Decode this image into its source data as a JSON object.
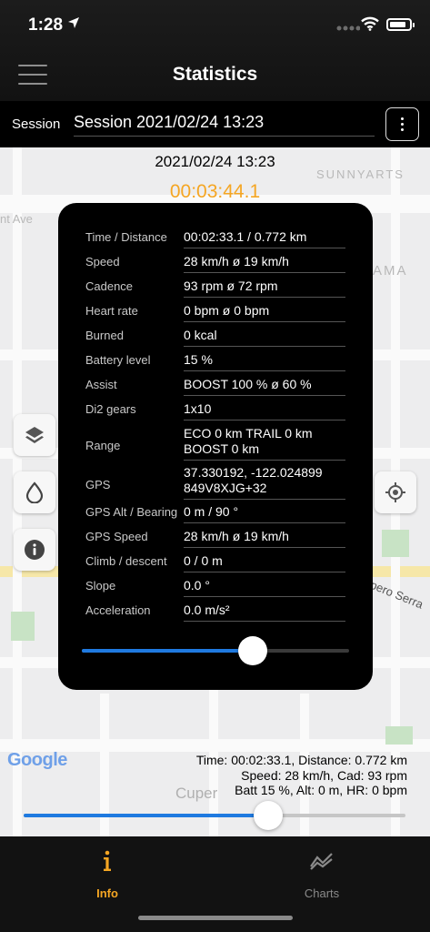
{
  "status_bar": {
    "time": "1:28"
  },
  "header": {
    "title": "Statistics"
  },
  "session": {
    "label": "Session",
    "value": "Session 2021/02/24 13:23"
  },
  "main": {
    "date": "2021/02/24 13:23",
    "elapsed": "00:03:44.1"
  },
  "map_labels": [
    "SUNNYARTS",
    "nt Ave",
    "AMA",
    "upero Serra",
    "Cuper"
  ],
  "stats": [
    {
      "label": "Time / Distance",
      "value": "00:02:33.1 / 0.772 km"
    },
    {
      "label": "Speed",
      "value": "28 km/h ø 19 km/h"
    },
    {
      "label": "Cadence",
      "value": "93 rpm ø 72 rpm"
    },
    {
      "label": "Heart rate",
      "value": "0 bpm ø 0 bpm"
    },
    {
      "label": "Burned",
      "value": "0 kcal"
    },
    {
      "label": "Battery level",
      "value": "15 %"
    },
    {
      "label": "Assist",
      "value": "BOOST 100 % ø 60 %"
    },
    {
      "label": "Di2 gears",
      "value": "1x10"
    },
    {
      "label": "Range",
      "value": "ECO 0 km TRAIL 0 km BOOST 0 km"
    },
    {
      "label": "GPS",
      "value": "37.330192, -122.024899 849V8XJG+32"
    },
    {
      "label": "GPS Alt / Bearing",
      "value": "0 m / 90 °"
    },
    {
      "label": "GPS Speed",
      "value": "28 km/h ø 19 km/h"
    },
    {
      "label": "Climb / descent",
      "value": "0 / 0 m"
    },
    {
      "label": "Slope",
      "value": "0.0 °"
    },
    {
      "label": "Acceleration",
      "value": "0.0 m/s²"
    }
  ],
  "panel_slider": {
    "value": 0.64
  },
  "map_attribution": "Google",
  "summary": {
    "line1": "Time: 00:02:33.1, Distance: 0.772 km",
    "line2": "Speed: 28 km/h, Cad: 93 rpm",
    "line3": "Batt 15 %, Alt: 0 m, HR: 0 bpm"
  },
  "bottom_slider": {
    "value": 0.64
  },
  "tabs": [
    {
      "label": "Info",
      "icon": "info-icon",
      "active": true
    },
    {
      "label": "Charts",
      "icon": "chart-icon",
      "active": false
    }
  ],
  "colors": {
    "accent": "#f5a623",
    "slider": "#1f7ae0"
  }
}
